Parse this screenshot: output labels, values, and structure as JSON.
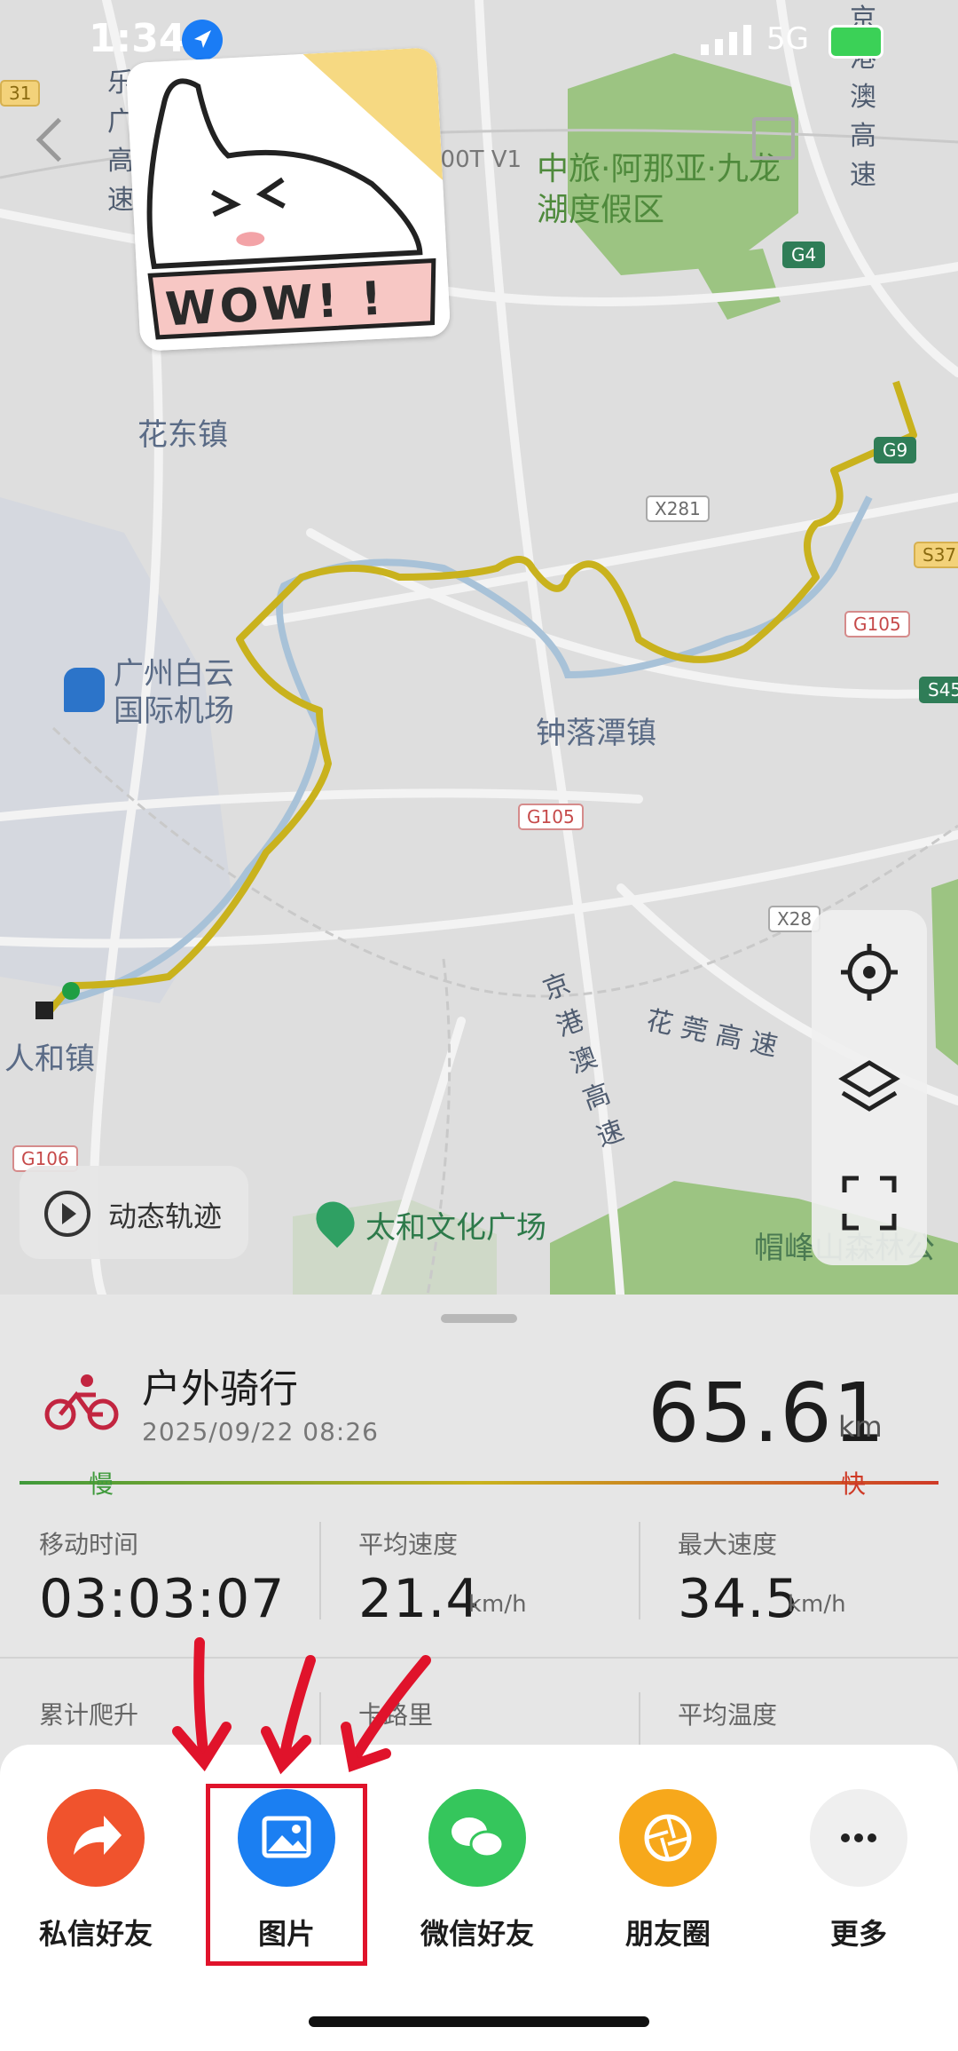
{
  "status_bar": {
    "time": "1:34",
    "network": "5G"
  },
  "sticker": {
    "text": "WOW! !"
  },
  "map": {
    "top_label_partial": "300T V1",
    "places": {
      "resort": "中旅·阿那亚·九龙湖度假区",
      "huadong": "花东镇",
      "airport": "广州白云国际机场",
      "zhongluotan": "钟落潭镇",
      "renhe": "人和镇",
      "taihe": "太和文化广场",
      "maofeng": "帽峰山森林公"
    },
    "roads": {
      "expressway_left": "乐广高速",
      "expressway_right": "京港澳高速",
      "expressway_center": "京港澳高速",
      "huaguan": "花莞高速"
    },
    "badges": {
      "g4": "G4",
      "g9": "G9",
      "x281_top": "X281",
      "x281_right": "X28",
      "s37": "S37",
      "g105_right": "G105",
      "g105_center": "G105",
      "s45": "S45",
      "g106": "G106",
      "left_edge": "31"
    },
    "dynamic_track_label": "动态轨迹",
    "controls": [
      "locate-icon",
      "layers-icon",
      "fullscreen-icon"
    ]
  },
  "activity": {
    "title": "户外骑行",
    "datetime": "2025/09/22 08:26",
    "distance": "65.61",
    "distance_unit": "km",
    "speed_legend": {
      "slow": "慢",
      "fast": "快"
    },
    "stats_row1": [
      {
        "label": "移动时间",
        "value": "03:03:07",
        "unit": ""
      },
      {
        "label": "平均速度",
        "value": "21.4",
        "unit": "km/h"
      },
      {
        "label": "最大速度",
        "value": "34.5",
        "unit": "km/h"
      }
    ],
    "stats_row2": [
      {
        "label": "累计爬升"
      },
      {
        "label": "卡路里"
      },
      {
        "label": "平均温度"
      }
    ]
  },
  "share": {
    "items": [
      {
        "label": "私信好友",
        "color": "#f0532d",
        "icon": "share-arrow-icon"
      },
      {
        "label": "图片",
        "color": "#1b7ff2",
        "icon": "image-icon"
      },
      {
        "label": "微信好友",
        "color": "#35c65c",
        "icon": "wechat-icon"
      },
      {
        "label": "朋友圈",
        "color": "#f7a81b",
        "icon": "moments-icon"
      },
      {
        "label": "更多",
        "color": "#efefef",
        "icon": "more-icon"
      }
    ]
  },
  "colors": {
    "highlight": "#e0132b",
    "route": "#c9b21d",
    "green_area": "#8fbf72"
  }
}
